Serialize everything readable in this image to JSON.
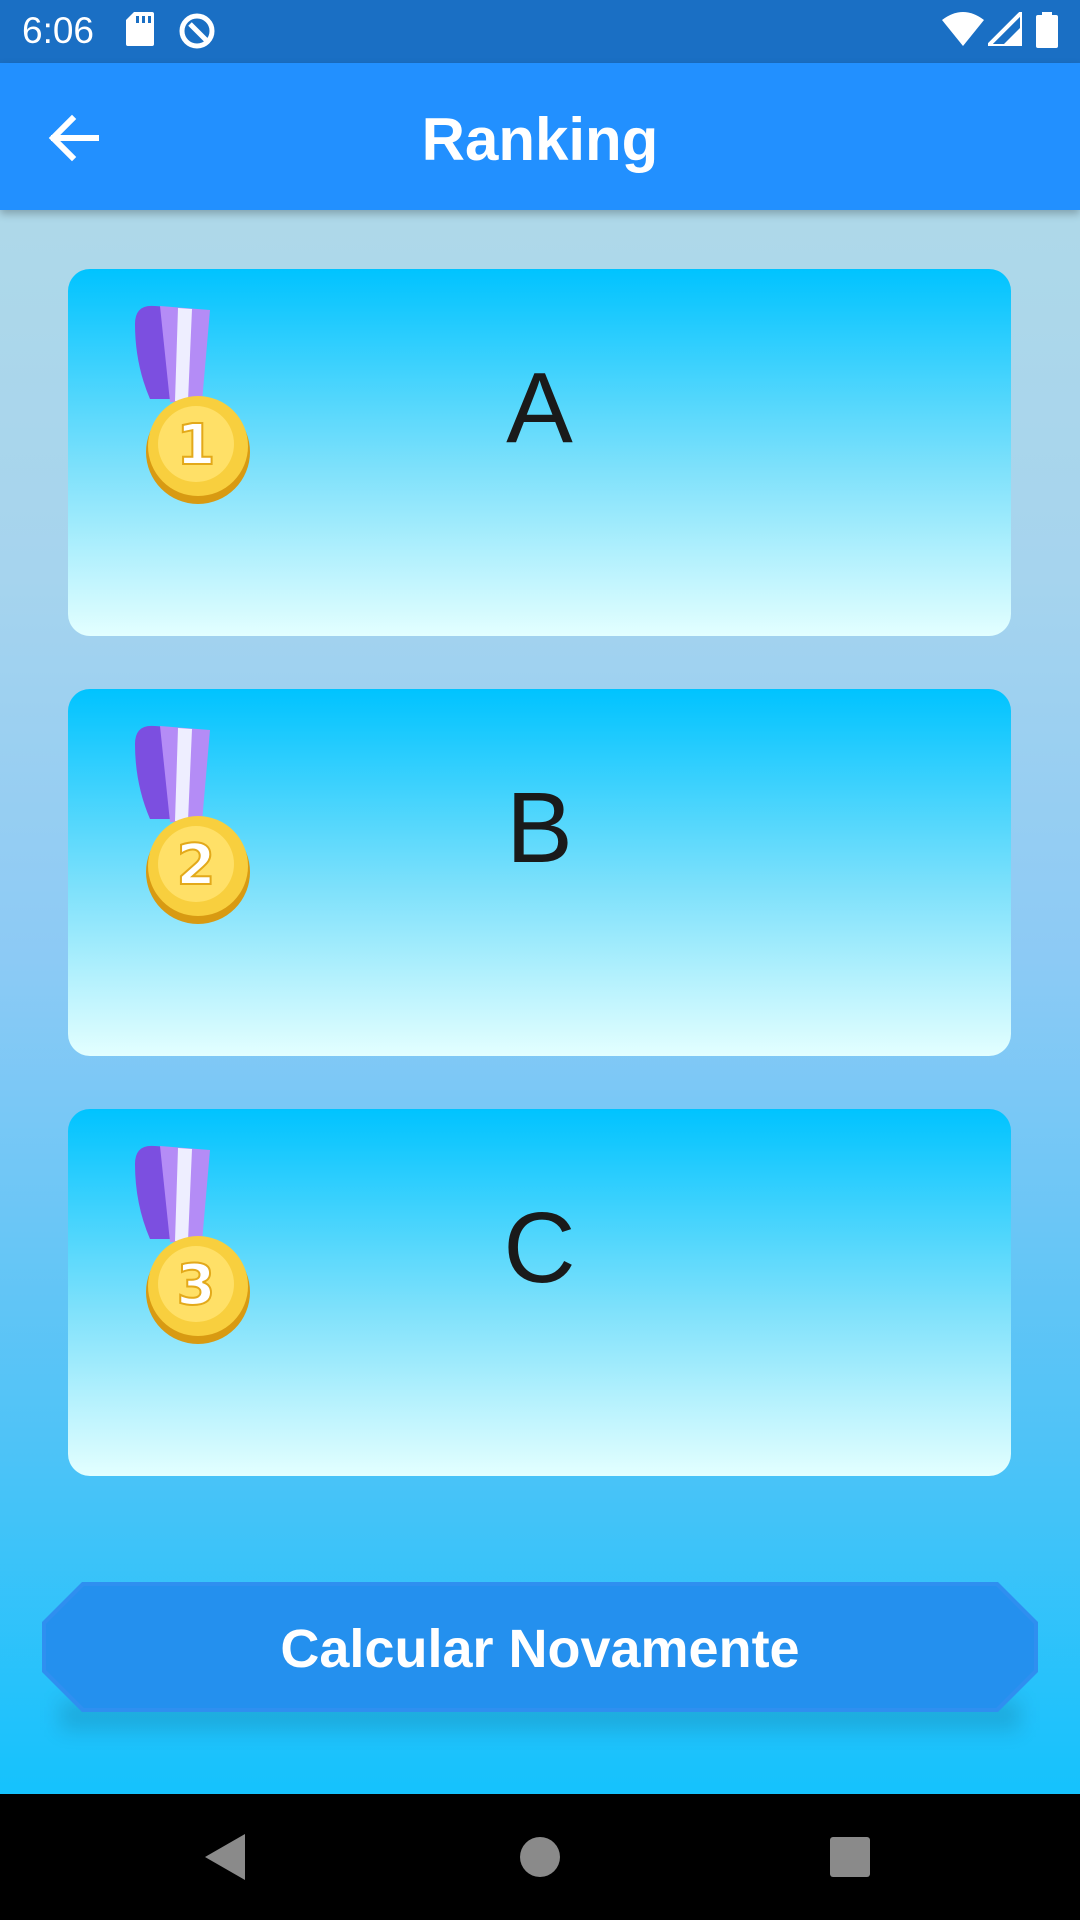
{
  "status_bar": {
    "time": "6:06"
  },
  "app_bar": {
    "title": "Ranking"
  },
  "ranking": [
    {
      "position": "1",
      "name": "A"
    },
    {
      "position": "2",
      "name": "B"
    },
    {
      "position": "3",
      "name": "C"
    }
  ],
  "button": {
    "label": "Calcular Novamente"
  },
  "colors": {
    "status_bar": "#1a6fc4",
    "app_bar": "#2290ff",
    "button": "#2490ee",
    "medal_gold": "#f6c33a",
    "ribbon": "#9b6cf0"
  },
  "icons": [
    "back-arrow-icon",
    "sd-card-icon",
    "sync-icon",
    "wifi-icon",
    "signal-icon",
    "battery-icon",
    "medal-icon",
    "nav-back-icon",
    "nav-home-icon",
    "nav-recents-icon"
  ]
}
